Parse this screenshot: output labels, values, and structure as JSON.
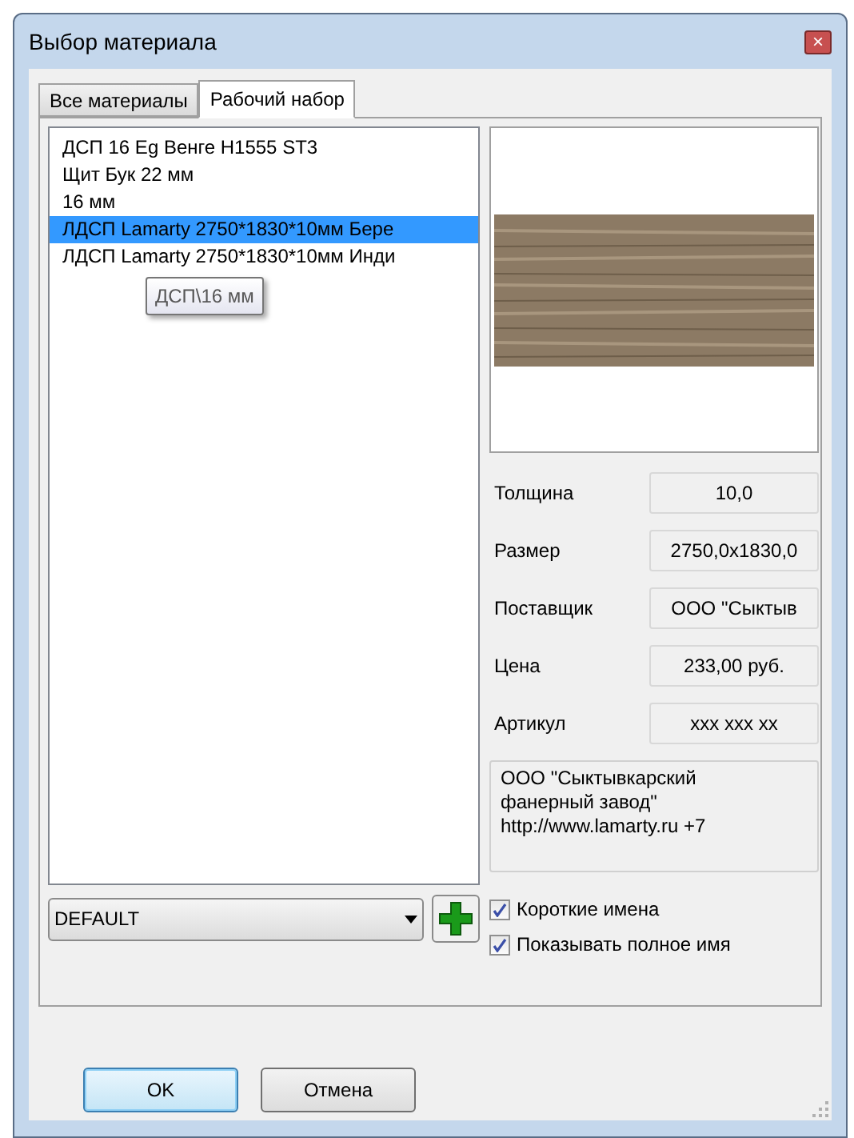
{
  "window": {
    "title": "Выбор материала",
    "close": "×"
  },
  "tabs": [
    {
      "label": "Все материалы",
      "selected": false
    },
    {
      "label": "Рабочий набор",
      "selected": true
    }
  ],
  "materials": [
    {
      "label": "ДСП 16 Eg Венге H1555 ST3",
      "selected": false
    },
    {
      "label": "Щит Бук 22 мм",
      "selected": false
    },
    {
      "label": "16 мм",
      "selected": false
    },
    {
      "label": "ЛДСП Lamarty 2750*1830*10мм Бере",
      "selected": true
    },
    {
      "label": "ЛДСП Lamarty 2750*1830*10мм Инди",
      "selected": false
    }
  ],
  "tooltip": "ДСП\\16 мм",
  "properties": [
    {
      "label": "Толщина",
      "value": "10,0"
    },
    {
      "label": "Размер",
      "value": "2750,0x1830,0"
    },
    {
      "label": "Поставщик",
      "value": "ООО \"Сыктыв"
    },
    {
      "label": "Цена",
      "value": "233,00  руб."
    },
    {
      "label": "Артикул",
      "value": "xxx xxx xx"
    }
  ],
  "supplier_info": [
    "ООО \"Сыктывкарский",
    "фанерный завод\"",
    "http://www.lamarty.ru  +7"
  ],
  "set_dropdown": {
    "value": "DEFAULT"
  },
  "options": [
    {
      "label": "Короткие имена",
      "checked": true
    },
    {
      "label": "Показывать полное имя",
      "checked": true
    }
  ],
  "buttons": [
    {
      "label": "OK",
      "kind": "default"
    },
    {
      "label": "Отмена",
      "kind": "normal"
    }
  ]
}
